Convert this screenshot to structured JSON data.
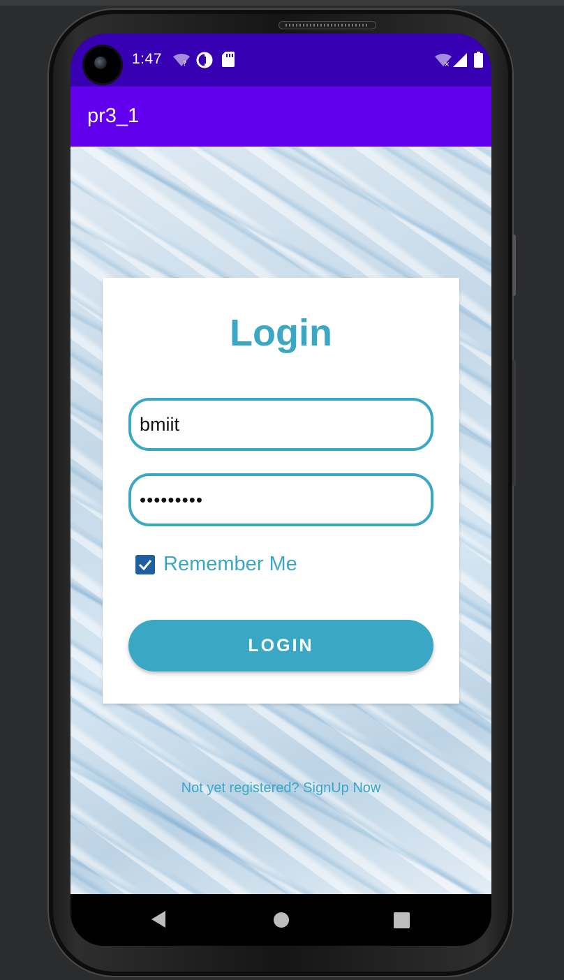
{
  "status_bar": {
    "time": "1:47",
    "icons": [
      "camera-cutout",
      "wifi-question-icon",
      "data-saver-icon",
      "sd-card-icon",
      "wifi-off-icon",
      "signal-icon",
      "battery-icon"
    ]
  },
  "app_bar": {
    "title": "pr3_1"
  },
  "login_card": {
    "title": "Login",
    "username_value": "bmiit",
    "password_value": "•••••••••",
    "remember_label": "Remember Me",
    "remember_checked": true,
    "login_button_label": "LOGIN"
  },
  "signup_link": "Not yet registered? SignUp Now",
  "navigation": {
    "icons": [
      "back-icon",
      "home-icon",
      "recents-icon"
    ]
  },
  "colors": {
    "status_bar": "#3700b3",
    "app_bar": "#6200ee",
    "accent": "#3aa8c4",
    "checkbox": "#1e5fa0"
  }
}
